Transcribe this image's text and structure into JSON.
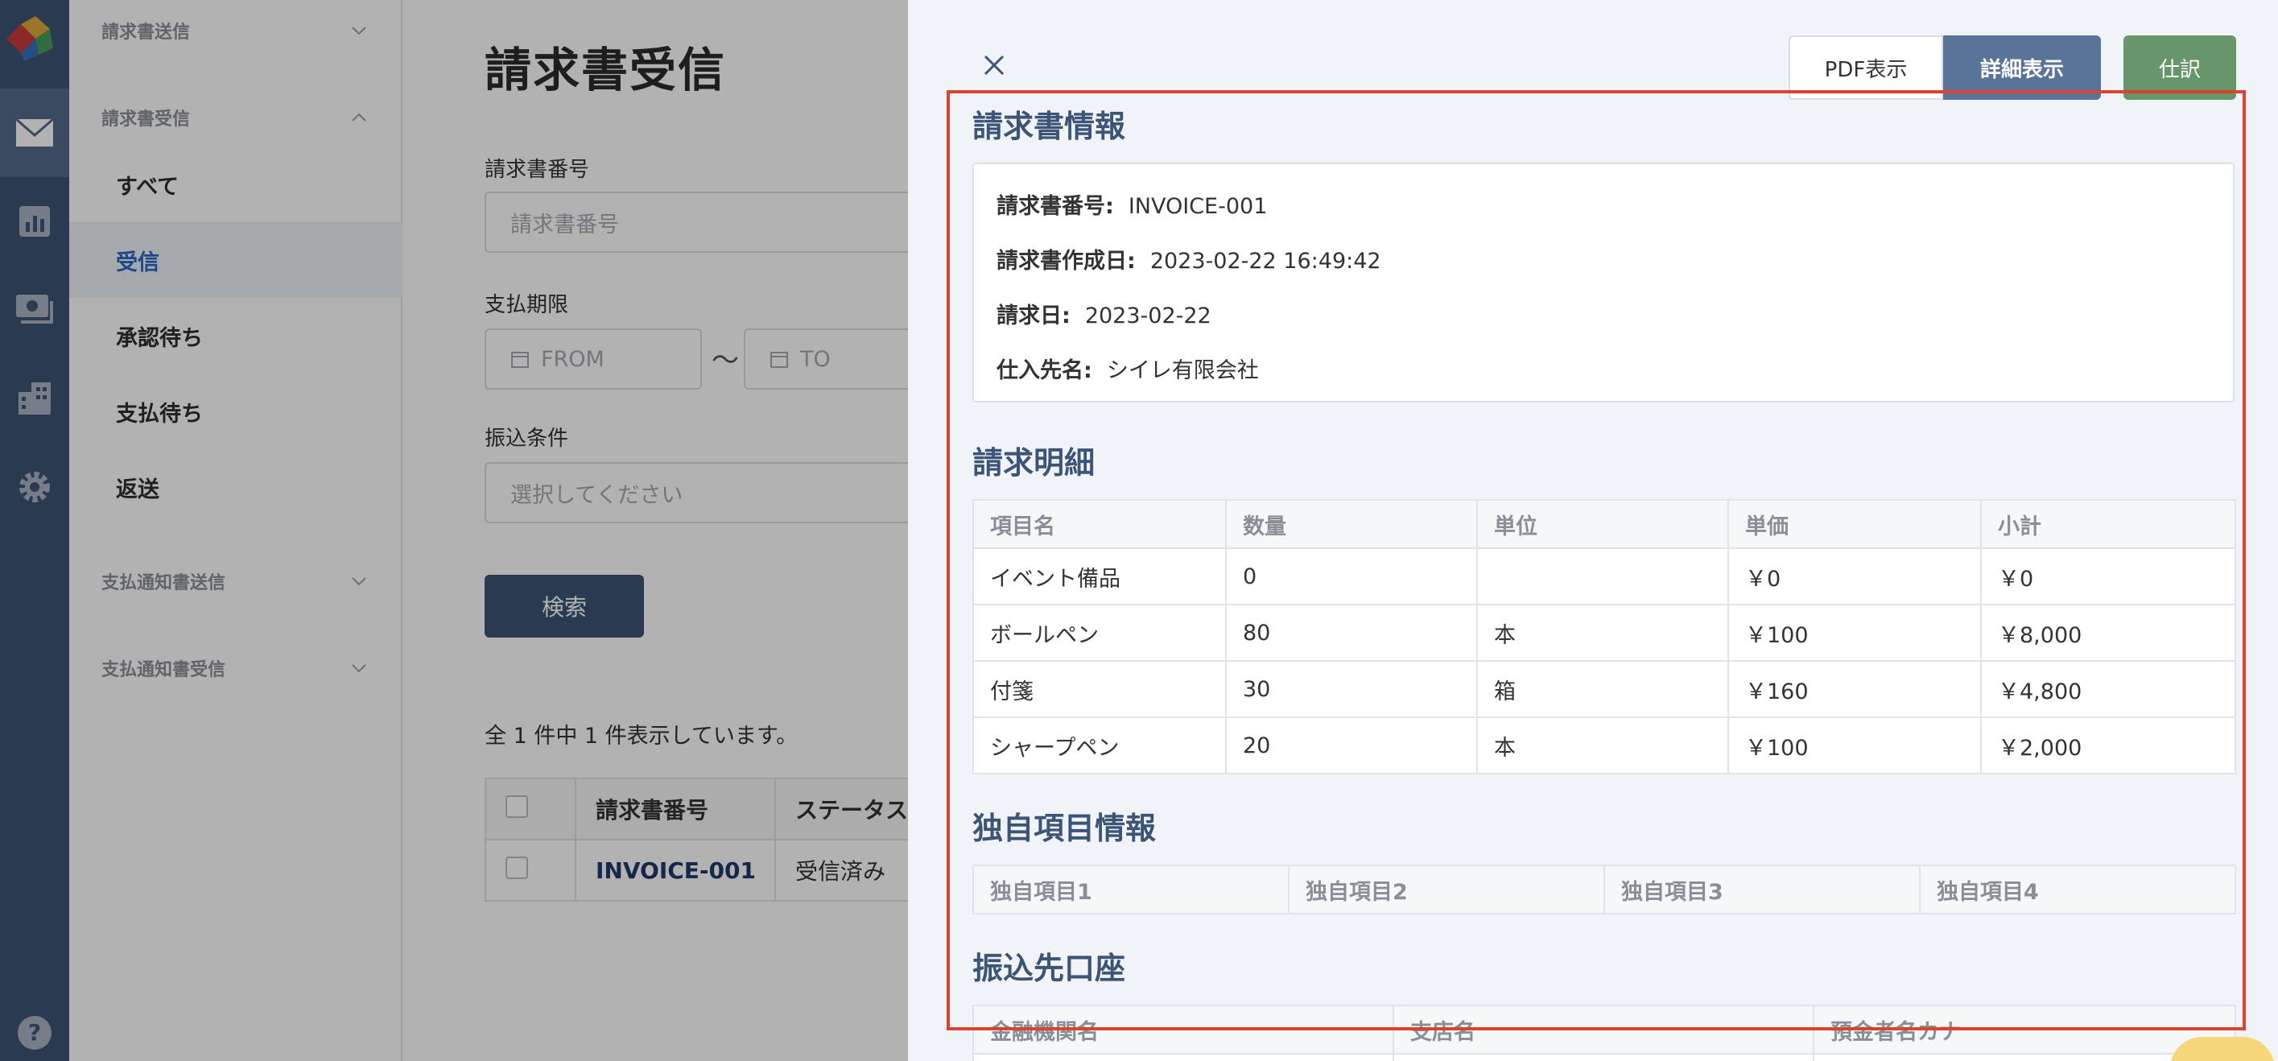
{
  "sidebar_groups": {
    "invoice_send": "請求書送信",
    "invoice_receive": "請求書受信",
    "payment_notice_send": "支払通知書送信",
    "payment_notice_receive": "支払通知書受信"
  },
  "sidebar_items": [
    "すべて",
    "受信",
    "承認待ち",
    "支払待ち",
    "返送"
  ],
  "rail_icons": [
    "logo-icon",
    "mail-icon",
    "chart-icon",
    "money-icon",
    "building-icon",
    "gear-icon",
    "help-icon"
  ],
  "page": {
    "title": "請求書受信",
    "invoice_number_label": "請求書番号",
    "invoice_number_placeholder": "請求書番号",
    "due_label": "支払期限",
    "from_placeholder": "FROM",
    "to_placeholder": "TO",
    "range_separator": "〜",
    "transfer_label": "振込条件",
    "transfer_placeholder": "選択してください",
    "search_button": "検索",
    "count_text": "全 1 件中 1 件表示しています。"
  },
  "results": {
    "headers": [
      "請求書番号",
      "ステータス"
    ],
    "rows": [
      {
        "invoice": "INVOICE-001",
        "status": "受信済み"
      }
    ]
  },
  "drawer": {
    "pdf_button": "PDF表示",
    "detail_button": "詳細表示",
    "journal_button": "仕訳",
    "invoice_info": {
      "title": "請求書情報",
      "rows": [
        {
          "label": "請求書番号:",
          "value": "INVOICE-001"
        },
        {
          "label": "請求書作成日:",
          "value": "2023-02-22 16:49:42"
        },
        {
          "label": "請求日:",
          "value": "2023-02-22"
        },
        {
          "label": "仕入先名:",
          "value": "シイレ有限会社"
        }
      ]
    },
    "details": {
      "title": "請求明細",
      "headers": [
        "項目名",
        "数量",
        "単位",
        "単価",
        "小計"
      ],
      "rows": [
        [
          "イベント備品",
          "0",
          "",
          "￥0",
          "￥0"
        ],
        [
          "ボールペン",
          "80",
          "本",
          "￥100",
          "￥8,000"
        ],
        [
          "付箋",
          "30",
          "箱",
          "￥160",
          "￥4,800"
        ],
        [
          "シャープペン",
          "20",
          "本",
          "￥100",
          "￥2,000"
        ]
      ]
    },
    "custom_fields": {
      "title": "独自項目情報",
      "headers": [
        "独自項目1",
        "独自項目2",
        "独自項目3",
        "独自項目4"
      ]
    },
    "bank_account": {
      "title": "振込先口座",
      "headers": [
        "金融機関名",
        "支店名",
        "預金者名カナ"
      ]
    }
  },
  "colors": {
    "rail": "#3c5475",
    "accent_blue": "#2b66c6",
    "section_title": "#3c5475",
    "journal_green": "#66966a",
    "highlight_red": "#d9432f"
  }
}
